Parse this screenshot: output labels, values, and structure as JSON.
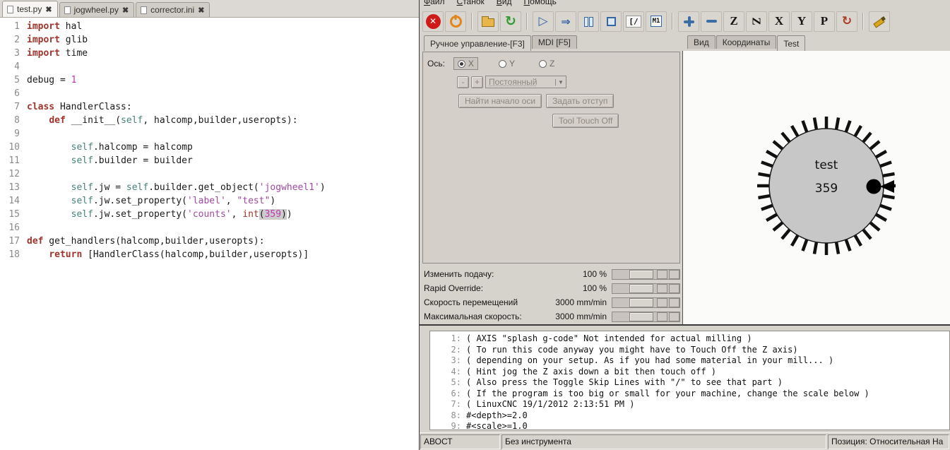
{
  "editor": {
    "close_glyph": "✖",
    "tabs": [
      {
        "label": "test.py"
      },
      {
        "label": "jogwheel.py"
      },
      {
        "label": "corrector.ini"
      }
    ],
    "lines": [
      {
        "n": "1",
        "s": [
          {
            "c": "k",
            "t": "import"
          },
          {
            "t": " hal"
          }
        ]
      },
      {
        "n": "2",
        "s": [
          {
            "c": "k",
            "t": "import"
          },
          {
            "t": " glib"
          }
        ]
      },
      {
        "n": "3",
        "s": [
          {
            "c": "k",
            "t": "import"
          },
          {
            "t": " time"
          }
        ]
      },
      {
        "n": "4",
        "s": []
      },
      {
        "n": "5",
        "s": [
          {
            "t": "debug = "
          },
          {
            "c": "nu",
            "t": "1"
          }
        ]
      },
      {
        "n": "6",
        "s": []
      },
      {
        "n": "7",
        "s": [
          {
            "c": "k",
            "t": "class"
          },
          {
            "t": " HandlerClass:"
          }
        ]
      },
      {
        "n": "8",
        "s": [
          {
            "t": "    "
          },
          {
            "c": "k",
            "t": "def"
          },
          {
            "t": " __init__("
          },
          {
            "c": "sf",
            "t": "self"
          },
          {
            "t": ", halcomp,builder,useropts):"
          }
        ]
      },
      {
        "n": "9",
        "s": []
      },
      {
        "n": "10",
        "s": [
          {
            "t": "        "
          },
          {
            "c": "sf",
            "t": "self"
          },
          {
            "t": ".halcomp = halcomp"
          }
        ]
      },
      {
        "n": "11",
        "s": [
          {
            "t": "        "
          },
          {
            "c": "sf",
            "t": "self"
          },
          {
            "t": ".builder = builder"
          }
        ]
      },
      {
        "n": "12",
        "s": []
      },
      {
        "n": "13",
        "s": [
          {
            "t": "        "
          },
          {
            "c": "sf",
            "t": "self"
          },
          {
            "t": ".jw = "
          },
          {
            "c": "sf",
            "t": "self"
          },
          {
            "t": ".builder.get_object("
          },
          {
            "c": "st",
            "t": "'jogwheel1'"
          },
          {
            "t": ")"
          }
        ]
      },
      {
        "n": "14",
        "s": [
          {
            "t": "        "
          },
          {
            "c": "sf",
            "t": "self"
          },
          {
            "t": ".jw.set_property("
          },
          {
            "c": "st",
            "t": "'label'"
          },
          {
            "t": ", "
          },
          {
            "c": "st",
            "t": "\"test\""
          },
          {
            "t": ")"
          }
        ]
      },
      {
        "n": "15",
        "s": [
          {
            "t": "        "
          },
          {
            "c": "sf",
            "t": "self"
          },
          {
            "t": ".jw.set_property("
          },
          {
            "c": "st",
            "t": "'counts'"
          },
          {
            "t": ", "
          },
          {
            "c": "k2",
            "t": "int"
          },
          {
            "c": "hl",
            "t": "("
          },
          {
            "c": "nu hl",
            "t": "359"
          },
          {
            "c": "hl",
            "t": ")"
          },
          {
            "t": ")"
          }
        ]
      },
      {
        "n": "16",
        "s": []
      },
      {
        "n": "17",
        "s": [
          {
            "c": "k",
            "t": "def"
          },
          {
            "t": " get_handlers(halcomp,builder,useropts):"
          }
        ]
      },
      {
        "n": "18",
        "s": [
          {
            "t": "    "
          },
          {
            "c": "k",
            "t": "return"
          },
          {
            "t": " [HandlerClass(halcomp,builder,useropts)]"
          }
        ]
      }
    ]
  },
  "axis": {
    "menu": [
      "Файл",
      "Станок",
      "Вид",
      "Помощь"
    ],
    "toolbar": [
      {
        "name": "estop-button",
        "icon": "estop"
      },
      {
        "name": "machine-power-button",
        "icon": "power"
      },
      {
        "sep": true
      },
      {
        "name": "open-file-button",
        "icon": "folder"
      },
      {
        "name": "reload-file-button",
        "icon": "reload"
      },
      {
        "sep": true
      },
      {
        "name": "run-button",
        "icon": "run"
      },
      {
        "name": "run-from-line-button",
        "icon": "step"
      },
      {
        "name": "pause-button",
        "icon": "pause"
      },
      {
        "name": "stop-button",
        "icon": "stop"
      },
      {
        "name": "single-block-button",
        "icon": "block",
        "text": "[/"
      },
      {
        "name": "optional-stop-button",
        "icon": "m1",
        "text": "M1"
      },
      {
        "sep": true
      },
      {
        "name": "zoom-in-button",
        "icon": "zoomin"
      },
      {
        "name": "zoom-out-button",
        "icon": "zoomout"
      },
      {
        "name": "view-z-button",
        "icon": "letter",
        "text": "Z"
      },
      {
        "name": "view-z-rotated-button",
        "icon": "letter-rot",
        "text": "Z"
      },
      {
        "name": "view-x-button",
        "icon": "letter",
        "text": "X"
      },
      {
        "name": "view-y-button",
        "icon": "letter",
        "text": "Y"
      },
      {
        "name": "view-p-button",
        "icon": "letter",
        "text": "P"
      },
      {
        "name": "rotate-view-button",
        "icon": "rotate"
      },
      {
        "sep": true
      },
      {
        "name": "clear-plot-button",
        "icon": "brush"
      }
    ],
    "left_tabs": [
      {
        "label": "Ручное управление-[F3]",
        "active": true
      },
      {
        "label": "MDI [F5]",
        "active": false
      }
    ],
    "right_tabs": [
      {
        "label": "Вид",
        "active": false
      },
      {
        "label": "Координаты",
        "active": false
      },
      {
        "label": "Test",
        "active": true
      }
    ],
    "manual": {
      "axis_label": "Ось:",
      "axes": [
        {
          "label": "X",
          "selected": true
        },
        {
          "label": "Y",
          "selected": false
        },
        {
          "label": "Z",
          "selected": false
        }
      ],
      "minus": "-",
      "plus": "+",
      "increment": "Постоянный",
      "home_button": "Найти начало оси",
      "offset_button": "Задать отступ",
      "touchoff_button": "Tool Touch Off"
    },
    "sliders": [
      {
        "label": "Изменить подачу:",
        "value": "100 %"
      },
      {
        "label": "Rapid Override:",
        "value": "100 %"
      },
      {
        "label": "Скорость перемещений",
        "value": "3000 mm/min"
      },
      {
        "label": "Максимальная скорость:",
        "value": "3000 mm/min"
      }
    ],
    "jogwheel": {
      "label": "test",
      "counts": "359"
    },
    "gcode": [
      {
        "n": "1:",
        "t": "( AXIS \"splash g-code\" Not intended for actual milling )"
      },
      {
        "n": "2:",
        "t": "( To run this code anyway you might have to Touch Off the Z axis)"
      },
      {
        "n": "3:",
        "t": "( depending on your setup. As if you had some material in your mill... )"
      },
      {
        "n": "4:",
        "t": "( Hint jog the Z axis down a bit then touch off )"
      },
      {
        "n": "5:",
        "t": "( Also press the Toggle Skip Lines with \"/\" to see that part )"
      },
      {
        "n": "6:",
        "t": "( If the program is too big or small for your machine, change the scale below )"
      },
      {
        "n": "7:",
        "t": "( LinuxCNC 19/1/2012 2:13:51 PM )"
      },
      {
        "n": "8:",
        "t": "#<depth>=2.0"
      },
      {
        "n": "9:",
        "t": "#<scale>=1.0"
      }
    ],
    "statusbar": [
      {
        "t": "АВОСТ"
      },
      {
        "t": "Без инструмента"
      },
      {
        "t": "Позиция: Относительная На"
      }
    ]
  }
}
